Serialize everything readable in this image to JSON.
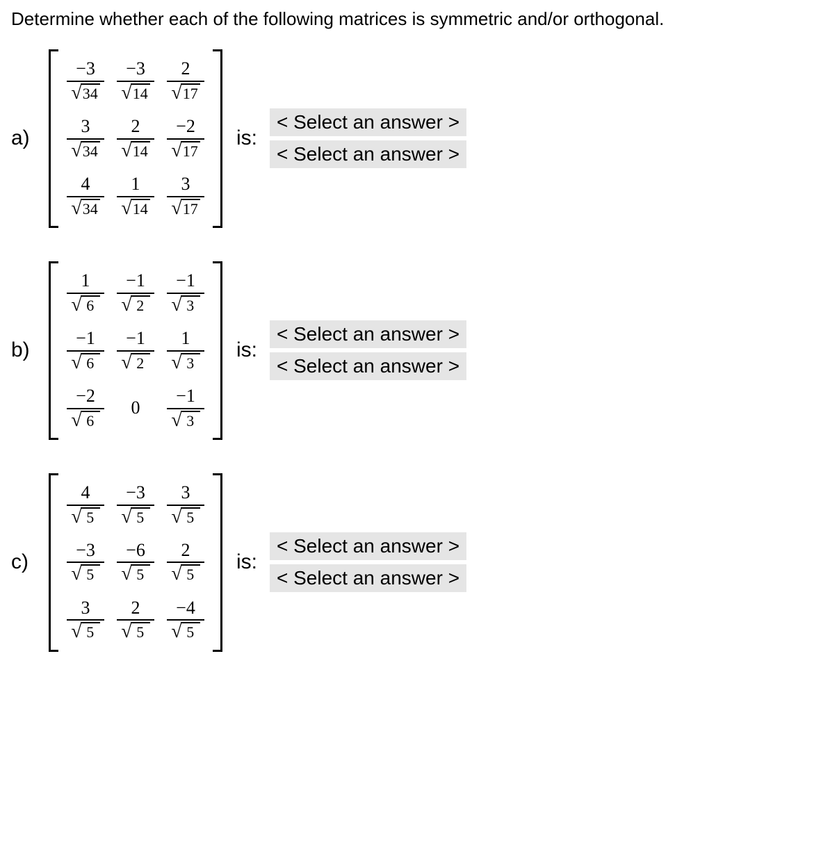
{
  "prompt": "Determine whether each of the following matrices is symmetric and/or orthogonal.",
  "is_label": "is:",
  "select_placeholder": "< Select an answer >",
  "parts": {
    "a": {
      "label": "a)",
      "matrix": [
        [
          {
            "num": "−3",
            "rad": "34"
          },
          {
            "num": "−3",
            "rad": "14"
          },
          {
            "num": "2",
            "rad": "17"
          }
        ],
        [
          {
            "num": "3",
            "rad": "34"
          },
          {
            "num": "2",
            "rad": "14"
          },
          {
            "num": "−2",
            "rad": "17"
          }
        ],
        [
          {
            "num": "4",
            "rad": "34"
          },
          {
            "num": "1",
            "rad": "14"
          },
          {
            "num": "3",
            "rad": "17"
          }
        ]
      ]
    },
    "b": {
      "label": "b)",
      "matrix": [
        [
          {
            "num": "1",
            "rad": "6"
          },
          {
            "num": "−1",
            "rad": "2"
          },
          {
            "num": "−1",
            "rad": "3"
          }
        ],
        [
          {
            "num": "−1",
            "rad": "6"
          },
          {
            "num": "−1",
            "rad": "2"
          },
          {
            "num": "1",
            "rad": "3"
          }
        ],
        [
          {
            "num": "−2",
            "rad": "6"
          },
          {
            "plain": "0"
          },
          {
            "num": "−1",
            "rad": "3"
          }
        ]
      ]
    },
    "c": {
      "label": "c)",
      "matrix": [
        [
          {
            "num": "4",
            "rad": "5"
          },
          {
            "num": "−3",
            "rad": "5"
          },
          {
            "num": "3",
            "rad": "5"
          }
        ],
        [
          {
            "num": "−3",
            "rad": "5"
          },
          {
            "num": "−6",
            "rad": "5"
          },
          {
            "num": "2",
            "rad": "5"
          }
        ],
        [
          {
            "num": "3",
            "rad": "5"
          },
          {
            "num": "2",
            "rad": "5"
          },
          {
            "num": "−4",
            "rad": "5"
          }
        ]
      ]
    }
  }
}
